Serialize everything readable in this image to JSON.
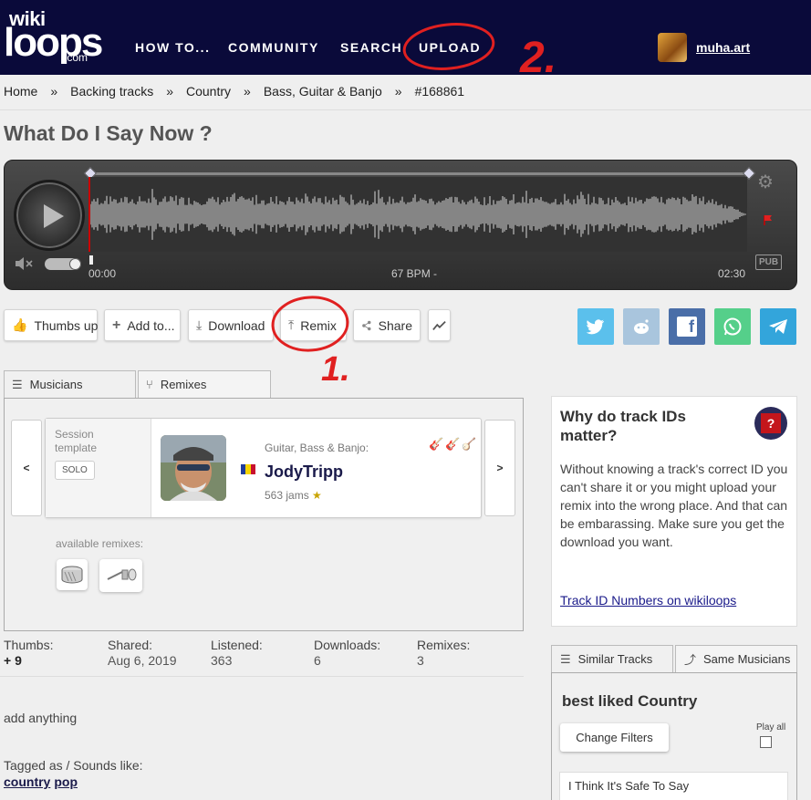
{
  "header": {
    "logo_wiki": "wiki",
    "logo_loops": "loops",
    "logo_com": ".com",
    "nav": [
      "HOW TO...",
      "COMMUNITY",
      "SEARCH",
      "UPLOAD"
    ],
    "username": "muha.art"
  },
  "breadcrumb": [
    "Home",
    "Backing tracks",
    "Country",
    "Bass, Guitar & Banjo",
    "#168861"
  ],
  "breadcrumb_sep": "»",
  "track": {
    "title": "What Do I Say Now ?"
  },
  "player": {
    "time_start": "00:00",
    "bpm": "67 BPM -",
    "time_end": "02:30",
    "pub": "PUB"
  },
  "actions": {
    "thumbs_up": "Thumbs up",
    "add_to": "Add to...",
    "download": "Download",
    "remix": "Remix",
    "share": "Share"
  },
  "social": [
    {
      "name": "twitter",
      "color": "#5bc0ec"
    },
    {
      "name": "reddit",
      "color": "#a9c5dd"
    },
    {
      "name": "facebook",
      "color": "#4a6ea8"
    },
    {
      "name": "whatsapp",
      "color": "#55cf8a"
    },
    {
      "name": "telegram",
      "color": "#33a5db"
    }
  ],
  "tabs": {
    "musicians": "Musicians",
    "remixes": "Remixes"
  },
  "musician_card": {
    "prev": "<",
    "next": ">",
    "session_label": "Session template",
    "solo": "SOLO",
    "instruments": "Guitar, Bass & Banjo:",
    "name": "JodyTripp",
    "jams": "563 jams"
  },
  "available_remixes_label": "available remixes:",
  "stats": [
    {
      "label": "Thumbs:",
      "value": "+ 9"
    },
    {
      "label": "Shared:",
      "value": "Aug 6, 2019"
    },
    {
      "label": "Listened:",
      "value": "363"
    },
    {
      "label": "Downloads:",
      "value": "6"
    },
    {
      "label": "Remixes:",
      "value": "3"
    }
  ],
  "description": "add anything",
  "tagged_label": "Tagged as / Sounds like:",
  "tags": [
    "country",
    "pop"
  ],
  "infobox": {
    "heading": "Why do track IDs matter?",
    "q": "?",
    "text": "Without knowing a track's correct ID you can't share it or you might upload your remix into the wrong place. And that can be embarassing. Make sure you get the download you want.",
    "link": "Track ID Numbers on wikiloops"
  },
  "similar": {
    "tab_similar": "Similar Tracks",
    "tab_same": "Same Musicians",
    "heading": "best liked Country",
    "change_filters": "Change Filters",
    "play_all": "Play all",
    "first_track": "I Think It's Safe To Say"
  },
  "annotations": [
    "1.",
    "2."
  ],
  "colors": {
    "header_bg": "#0a0a3a",
    "annotation_red": "#e02020"
  }
}
